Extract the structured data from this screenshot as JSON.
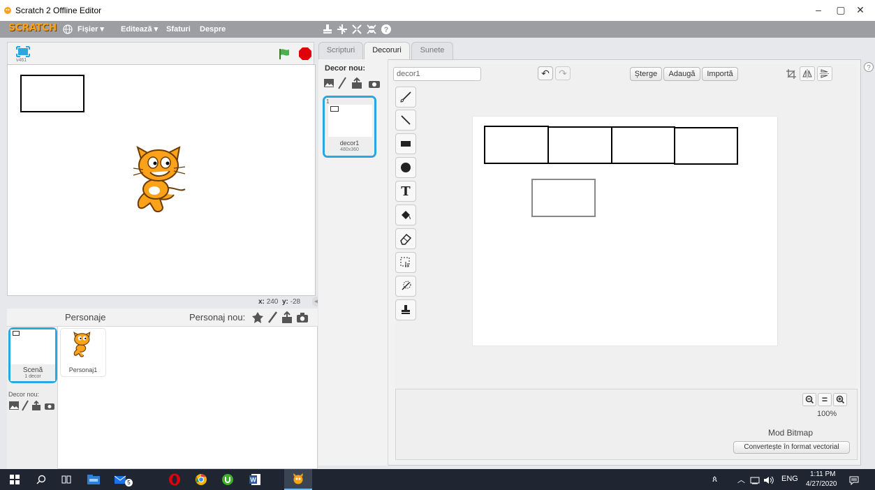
{
  "window": {
    "title": "Scratch 2 Offline Editor",
    "minimize": "–",
    "maximize": "▢",
    "close": "✕"
  },
  "menubar": {
    "logo": "SCRATCH",
    "items": [
      "Fișier ▾",
      "Editează ▾",
      "Sfaturi",
      "Despre"
    ]
  },
  "stage": {
    "version": "v461",
    "x_label": "x:",
    "x_value": "240",
    "y_label": "y:",
    "y_value": "-28"
  },
  "sprites": {
    "title": "Personaje",
    "new_label": "Personaj nou:",
    "stage_name": "Scenă",
    "stage_sub": "1 decor",
    "sprite1": "Personaj1",
    "backdrop_label": "Decor nou:"
  },
  "tabs": [
    "Scripturi",
    "Decoruri",
    "Sunete"
  ],
  "costumes": {
    "new_label": "Decor nou:",
    "item_number": "1",
    "item_name": "decor1",
    "item_size": "480x360"
  },
  "editor": {
    "name_value": "decor1",
    "delete_label": "Șterge",
    "add_label": "Adaugă",
    "import_label": "Importă",
    "zoom": "100%",
    "mode": "Mod Bitmap",
    "convert_label": "Convertește în format vectorial"
  },
  "taskbar": {
    "lang": "ENG",
    "time": "1:11 PM",
    "date": "4/27/2020",
    "mail_badge": "5"
  },
  "colors": {
    "accent": "#29a7e0",
    "menubar": "#9c9ea2",
    "taskbar": "#1f2631",
    "flag": "#4caf50",
    "stop": "#e0000b"
  }
}
